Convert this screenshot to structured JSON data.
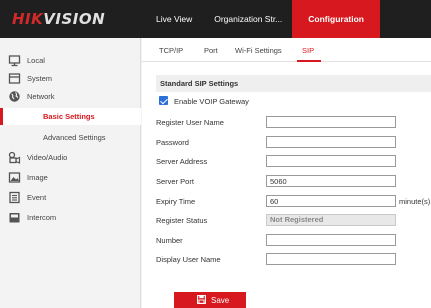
{
  "brand": {
    "prefix": "HIK",
    "suffix": "VISION"
  },
  "top_nav": {
    "items": [
      {
        "label": "Live View"
      },
      {
        "label": "Organization Str..."
      },
      {
        "label": "Configuration"
      }
    ]
  },
  "sidebar": {
    "items": [
      {
        "label": "Local",
        "icon": "monitor-icon"
      },
      {
        "label": "System",
        "icon": "system-icon"
      },
      {
        "label": "Network",
        "icon": "globe-icon"
      },
      {
        "label": "Basic Settings"
      },
      {
        "label": "Advanced Settings"
      },
      {
        "label": "Video/Audio",
        "icon": "video-audio-icon"
      },
      {
        "label": "Image",
        "icon": "image-icon"
      },
      {
        "label": "Event",
        "icon": "event-icon"
      },
      {
        "label": "Intercom",
        "icon": "intercom-icon"
      }
    ]
  },
  "tabs": [
    {
      "label": "TCP/IP"
    },
    {
      "label": "Port"
    },
    {
      "label": "Wi-Fi Settings"
    },
    {
      "label": "SIP"
    }
  ],
  "form": {
    "section_title": "Standard SIP Settings",
    "enable_voip_label": "Enable VOIP Gateway",
    "enable_voip_checked": true,
    "register_user_name": {
      "label": "Register User Name",
      "value": ""
    },
    "password": {
      "label": "Password",
      "value": ""
    },
    "server_address": {
      "label": "Server Address",
      "value": ""
    },
    "server_port": {
      "label": "Server Port",
      "value": "5060"
    },
    "expiry_time": {
      "label": "Expiry Time",
      "value": "60",
      "unit": "minute(s)"
    },
    "register_status": {
      "label": "Register Status",
      "value": "Not Registered"
    },
    "number": {
      "label": "Number",
      "value": ""
    },
    "display_user_name": {
      "label": "Display User Name",
      "value": ""
    }
  },
  "save_label": "Save",
  "colors": {
    "accent": "#d7181e",
    "topbar": "#1f1f1f",
    "checkbox": "#2b6fd8"
  }
}
